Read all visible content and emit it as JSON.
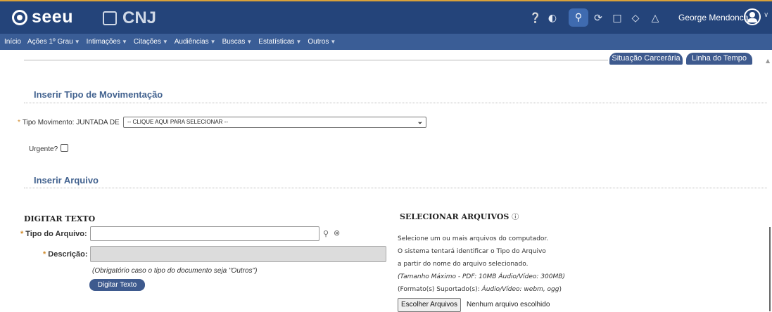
{
  "brand": {
    "name": "seeu",
    "partner": "CNJ"
  },
  "header": {
    "user_name": "George Mendonca",
    "icons": [
      "help-icon",
      "contrast-icon",
      "search-icon",
      "history-icon",
      "bookmark-icon",
      "tag-icon",
      "bell-icon"
    ]
  },
  "menu": [
    {
      "label": "Início",
      "caret": false
    },
    {
      "label": "Ações 1º Grau",
      "caret": true
    },
    {
      "label": "Intimações",
      "caret": true
    },
    {
      "label": "Citações",
      "caret": true
    },
    {
      "label": "Audiências",
      "caret": true
    },
    {
      "label": "Buscas",
      "caret": true
    },
    {
      "label": "Estatísticas",
      "caret": true
    },
    {
      "label": "Outros",
      "caret": true
    }
  ],
  "tabs": {
    "situacao": "Situação Carcerária",
    "linha": "Linha do Tempo"
  },
  "movimentacao": {
    "title": "Inserir Tipo de Movimentação",
    "tipo_label": "Tipo Movimento:",
    "tipo_prefix": "JUNTADA DE",
    "select_value": "-- CLIQUE AQUI PARA SELECIONAR --",
    "urgente_label": "Urgente?",
    "urgente_checked": false
  },
  "arquivo": {
    "title": "Inserir Arquivo",
    "digitar_head": "DIGITAR TEXTO",
    "tipo_label": "Tipo do Arquivo:",
    "tipo_value": "",
    "descricao_label": "Descrição:",
    "descricao_value": "",
    "note": "(Obrigatório caso o tipo do documento seja \"Outros\")",
    "digitar_button": "Digitar Texto",
    "selecionar_head": "SELECIONAR ARQUIVOS",
    "info_1": "Selecione um ou mais arquivos do computador.",
    "info_2": "O sistema tentará identificar o Tipo do Arquivo",
    "info_3": "a partir do nome do arquivo selecionado.",
    "info_4": "(Tamanho Máximo - PDF: 10MB  Áudio/Vídeo: 300MB)",
    "info_5_prefix": "(Formato(s) Suportado(s):",
    "info_5_formats": "Áudio/Vídeo: webm, ogg",
    "info_5_suffix": ")",
    "choose_button": "Escolher Arquivos",
    "no_file": "Nenhum arquivo escolhido"
  },
  "colors": {
    "header": "#24447a",
    "menubar": "#3a5d96",
    "accent": "#3e5a8e",
    "section": "#42628f",
    "required": "#d08a2c"
  }
}
